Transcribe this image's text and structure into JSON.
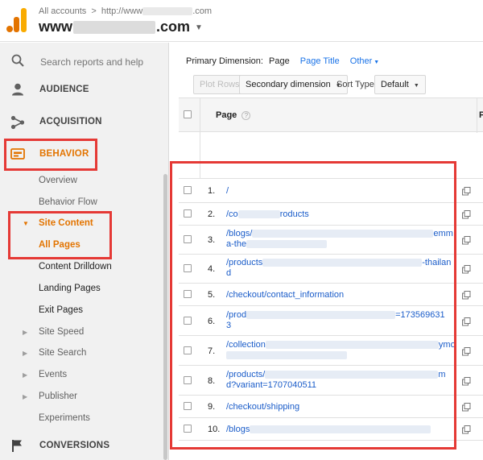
{
  "header": {
    "crumb_root": "All accounts",
    "crumb_sep": ">",
    "crumb_prefix": "http://www",
    "crumb_suffix": ".com",
    "account_prefix": "www",
    "account_suffix": ".com"
  },
  "sidebar": {
    "search_placeholder": "Search reports and help",
    "audience": "AUDIENCE",
    "acquisition": "ACQUISITION",
    "behavior": "BEHAVIOR",
    "overview": "Overview",
    "behavior_flow": "Behavior Flow",
    "site_content": "Site Content",
    "all_pages": "All Pages",
    "content_drilldown": "Content Drilldown",
    "landing_pages": "Landing Pages",
    "exit_pages": "Exit Pages",
    "site_speed": "Site Speed",
    "site_search": "Site Search",
    "events": "Events",
    "publisher": "Publisher",
    "experiments": "Experiments",
    "conversions": "CONVERSIONS"
  },
  "main": {
    "primary_dimension_label": "Primary Dimension:",
    "dim_page": "Page",
    "dim_page_title": "Page Title",
    "dim_other": "Other",
    "plot_rows": "Plot Rows",
    "secondary_dimension": "Secondary dimension",
    "sort_type_label": "Sort Type:",
    "sort_type_value": "Default",
    "col_page": "Page",
    "col_edge": "P",
    "rows": [
      {
        "num": "1.",
        "l1a": "/",
        "l1b": "",
        "l2": ""
      },
      {
        "num": "2.",
        "l1a": "/co",
        "l1b": "roducts",
        "l2": ""
      },
      {
        "num": "3.",
        "l1a": "/blogs/",
        "l1b": "emm",
        "l2": "a-the"
      },
      {
        "num": "4.",
        "l1a": "/products",
        "l1b": "-thailan",
        "l2": "d"
      },
      {
        "num": "5.",
        "l1a": "/checkout/contact_information",
        "l1b": "",
        "l2": ""
      },
      {
        "num": "6.",
        "l1a": "/prod",
        "l1b": "=173569631",
        "l2": "3"
      },
      {
        "num": "7.",
        "l1a": "/collection",
        "l1b": "ymo",
        "l2": ""
      },
      {
        "num": "8.",
        "l1a": "/products/",
        "l1b": "m",
        "l2": "d?variant=1707040511"
      },
      {
        "num": "9.",
        "l1a": "/checkout/shipping",
        "l1b": "",
        "l2": ""
      },
      {
        "num": "10.",
        "l1a": "/blogs",
        "l1b": "",
        "l2": ""
      }
    ]
  },
  "colors": {
    "accent_orange": "#e37400",
    "highlight_red": "#e53935",
    "link_blue": "#1a5cc9"
  }
}
